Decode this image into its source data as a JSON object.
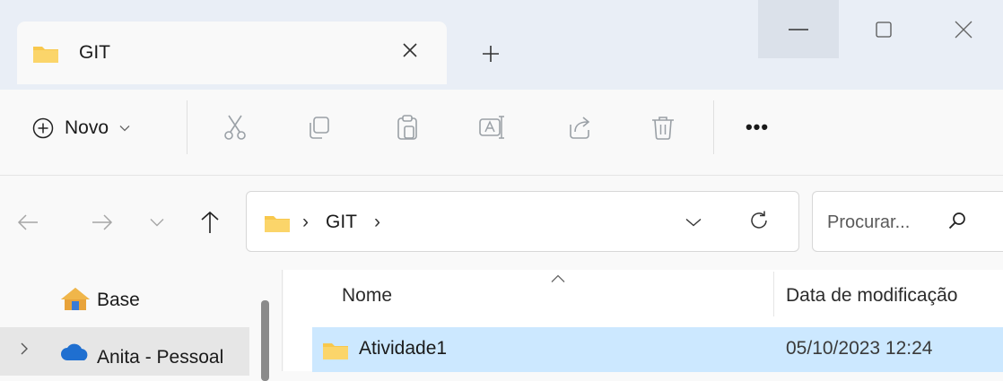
{
  "window": {
    "tab_title": "GIT",
    "tab_close": "close-tab",
    "new_tab": "new-tab"
  },
  "toolbar": {
    "new_label": "Novo",
    "more_label": "•••",
    "icons": [
      "add-circle-icon",
      "cut-icon",
      "copy-icon",
      "paste-icon",
      "rename-icon",
      "share-icon",
      "delete-icon",
      "more-icon"
    ]
  },
  "navigation": {
    "breadcrumb": [
      "GIT"
    ],
    "breadcrumb_separator": "›",
    "search_placeholder": "Procurar..."
  },
  "sidebar": {
    "items": [
      {
        "label": "Base",
        "icon": "home-icon",
        "selected": false
      },
      {
        "label": "Anita - Pessoal",
        "icon": "onedrive-cloud-icon",
        "selected": true
      }
    ]
  },
  "file_list": {
    "columns": [
      "Nome",
      "Data de modificação"
    ],
    "rows": [
      {
        "name": "Atividade1",
        "modified": "05/10/2023 12:24",
        "type": "folder",
        "selected": true
      }
    ]
  },
  "colors": {
    "accent": "#0067c0",
    "folder": "#f8c84d",
    "selection": "#cce8ff",
    "onedrive": "#1f6fd0"
  }
}
